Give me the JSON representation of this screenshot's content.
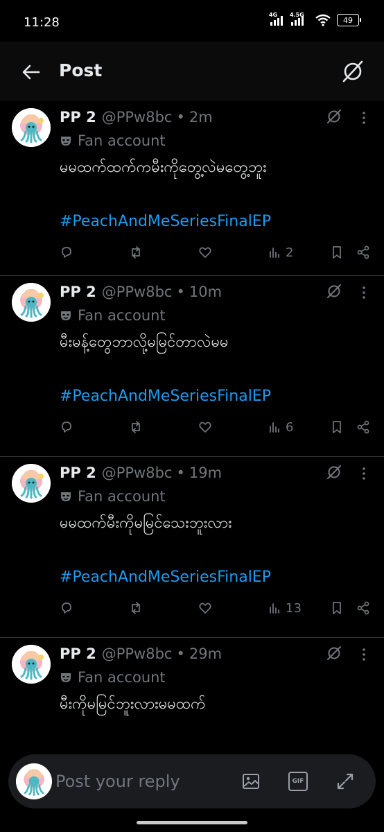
{
  "status_bar": {
    "time": "11:28",
    "net1": "4G",
    "net2": "4.5G",
    "battery": "49"
  },
  "header": {
    "title": "Post",
    "back_icon": "arrow-left-icon",
    "grok_icon": "grok-icon"
  },
  "posts": [
    {
      "name": "PP 2",
      "handle": "@PPw8bc",
      "separator": "•",
      "age": "2m",
      "label": "Fan account",
      "text": "မမထက်ထက်ကမီးကိုတွေ့လဲမတွေ့ဘူး",
      "hashtag": "#PeachAndMeSeriesFinalEP",
      "views": "2"
    },
    {
      "name": "PP 2",
      "handle": "@PPw8bc",
      "separator": "•",
      "age": "10m",
      "label": "Fan account",
      "text": "မီးမန့်တွေဘာလို့မမြင်တာလဲမမ",
      "hashtag": "#PeachAndMeSeriesFinalEP",
      "views": "6"
    },
    {
      "name": "PP 2",
      "handle": "@PPw8bc",
      "separator": "•",
      "age": "19m",
      "label": "Fan account",
      "text": "မမထက်မီးကိုမမြင်သေးဘူးလား",
      "hashtag": "#PeachAndMeSeriesFinalEP",
      "views": "13"
    },
    {
      "name": "PP 2",
      "handle": "@PPw8bc",
      "separator": "•",
      "age": "29m",
      "label": "Fan account",
      "text": "မီးကိုမမြင်ဘူးလားမမထက်",
      "hashtag": "",
      "views": ""
    }
  ],
  "composer": {
    "placeholder": "Post your reply",
    "gif_label": "GIF"
  },
  "colors": {
    "background": "#000000",
    "text": "#e7e9ea",
    "muted": "#71767b",
    "link": "#1d9bf0",
    "divider": "#2f3336"
  }
}
